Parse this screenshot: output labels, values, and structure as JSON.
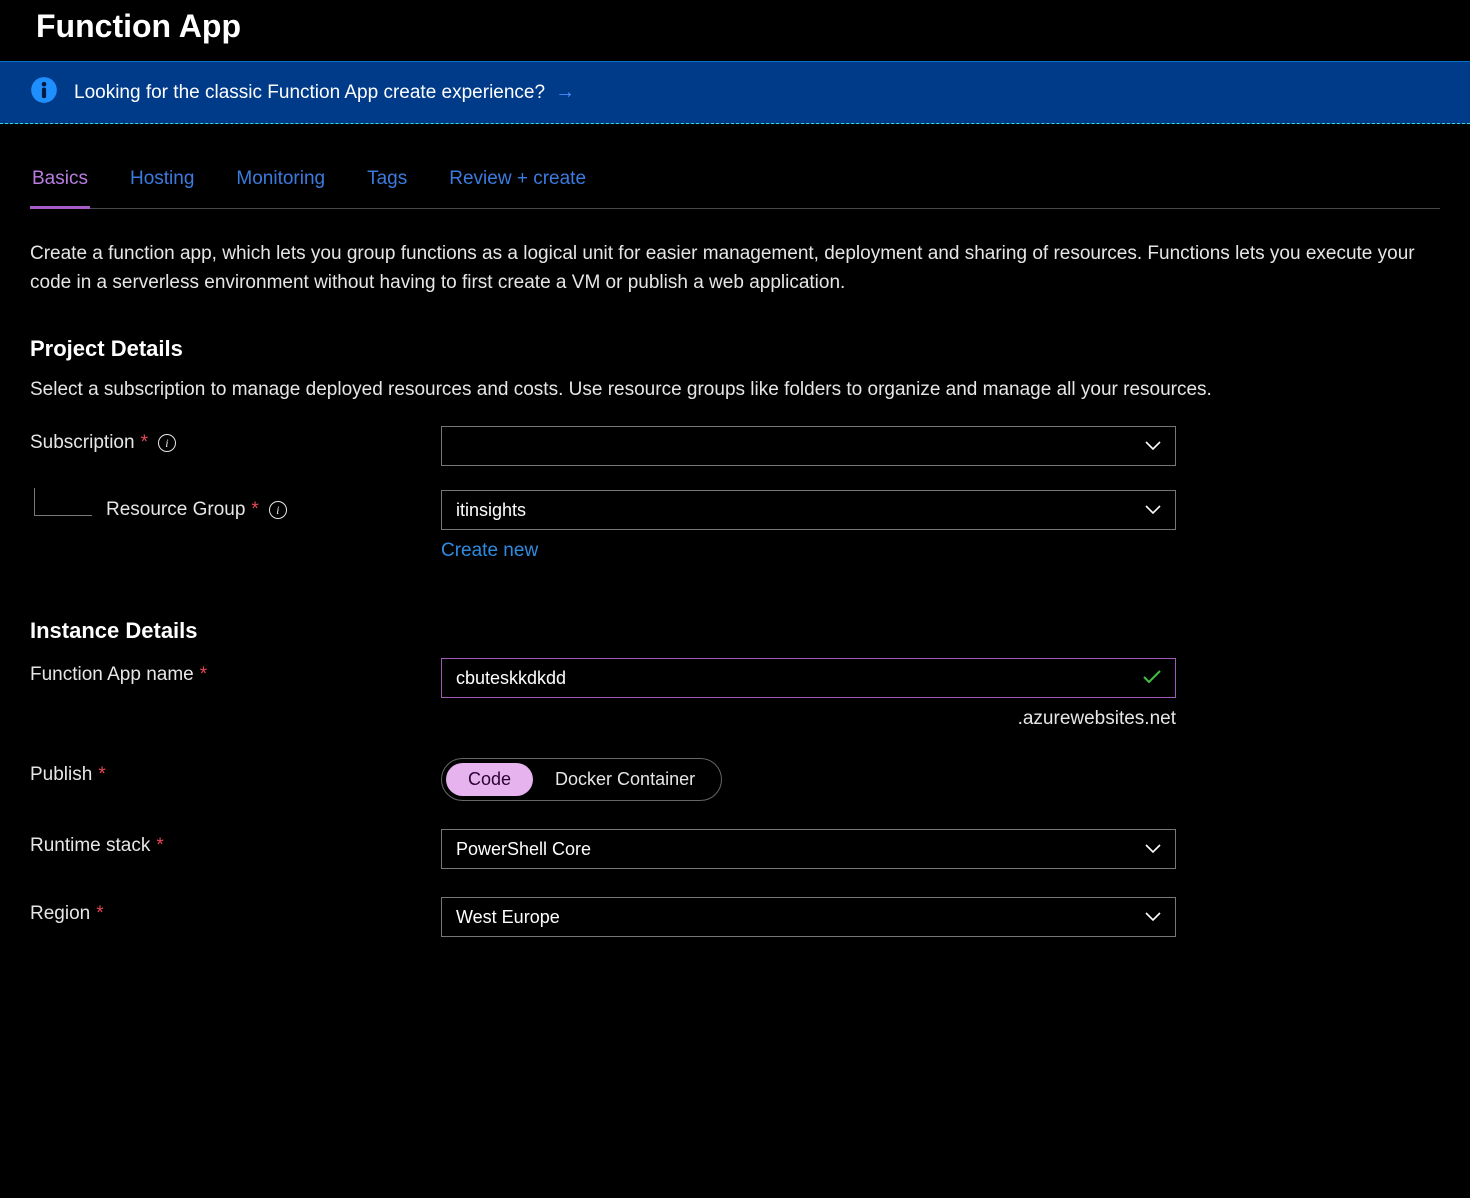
{
  "page_title": "Function App",
  "banner": {
    "text": "Looking for the classic Function App create experience?"
  },
  "tabs": [
    "Basics",
    "Hosting",
    "Monitoring",
    "Tags",
    "Review + create"
  ],
  "active_tab": "Basics",
  "description": "Create a function app, which lets you group functions as a logical unit for easier management, deployment and sharing of resources. Functions lets you execute your code in a serverless environment without having to first create a VM or publish a web application.",
  "sections": {
    "project": {
      "title": "Project Details",
      "subtitle": "Select a subscription to manage deployed resources and costs. Use resource groups like folders to organize and manage all your resources.",
      "subscription_label": "Subscription",
      "subscription_value": "",
      "resource_group_label": "Resource Group",
      "resource_group_value": "itinsights",
      "create_new": "Create new"
    },
    "instance": {
      "title": "Instance Details",
      "name_label": "Function App name",
      "name_value": "cbuteskkdkdd",
      "name_suffix": ".azurewebsites.net",
      "publish_label": "Publish",
      "publish_options": [
        "Code",
        "Docker Container"
      ],
      "publish_selected": "Code",
      "runtime_label": "Runtime stack",
      "runtime_value": "PowerShell Core",
      "region_label": "Region",
      "region_value": "West Europe"
    }
  }
}
